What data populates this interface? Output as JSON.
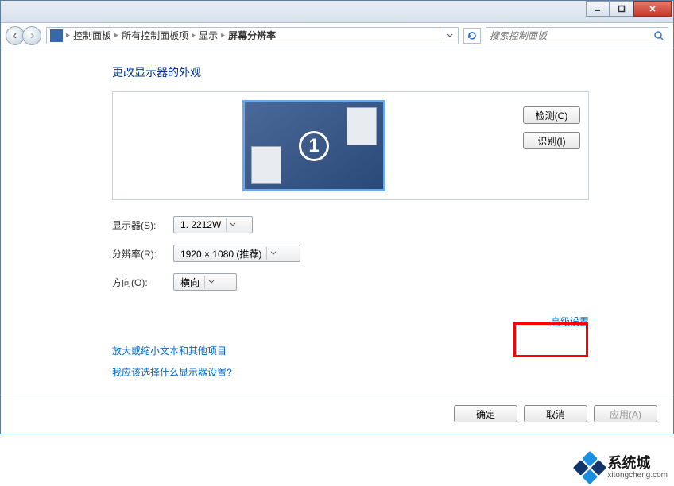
{
  "titlebar": {
    "min": "minimize",
    "max": "maximize",
    "close": "close"
  },
  "breadcrumb": {
    "items": [
      "控制面板",
      "所有控制面板项",
      "显示"
    ],
    "current": "屏幕分辨率"
  },
  "search": {
    "placeholder": "搜索控制面板"
  },
  "heading": "更改显示器的外观",
  "preview": {
    "monitor_number": "1",
    "detect_btn": "检测(C)",
    "identify_btn": "识别(I)"
  },
  "form": {
    "display_label": "显示器(S):",
    "display_value": "1. 2212W",
    "resolution_label": "分辨率(R):",
    "resolution_value": "1920 × 1080 (推荐)",
    "orientation_label": "方向(O):",
    "orientation_value": "横向"
  },
  "links": {
    "advanced": "高级设置",
    "text_size": "放大或缩小文本和其他项目",
    "which_settings": "我应该选择什么显示器设置?"
  },
  "footer": {
    "ok": "确定",
    "cancel": "取消",
    "apply": "应用(A)"
  },
  "watermark": {
    "main": "系统城",
    "sub": "xitongcheng.com"
  }
}
